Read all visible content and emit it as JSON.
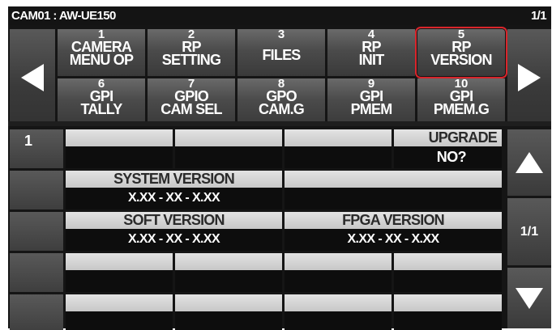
{
  "header": {
    "camera": "CAM01 : AW-UE150",
    "page": "1/1"
  },
  "menu": [
    {
      "num": "1",
      "label": "CAMERA\nMENU OP"
    },
    {
      "num": "2",
      "label": "RP\nSETTING"
    },
    {
      "num": "3",
      "label": "FILES"
    },
    {
      "num": "4",
      "label": "RP\nINIT"
    },
    {
      "num": "5",
      "label": "RP\nVERSION",
      "selected": true
    },
    {
      "num": "6",
      "label": "GPI\nTALLY"
    },
    {
      "num": "7",
      "label": "GPIO\nCAM SEL"
    },
    {
      "num": "8",
      "label": "GPO\nCAM.G"
    },
    {
      "num": "9",
      "label": "GPI\nPMEM"
    },
    {
      "num": "10",
      "label": "GPI\nPMEM.G"
    }
  ],
  "rows": {
    "row1": {
      "label": "1",
      "upgrade": "UPGRADE",
      "upgrade_value": "NO?"
    },
    "system_version": {
      "label": "SYSTEM VERSION",
      "value": "X.XX - XX - X.XX"
    },
    "soft_version": {
      "label": "SOFT VERSION",
      "value": "X.XX - XX - X.XX"
    },
    "fpga_version": {
      "label": "FPGA VERSION",
      "value": "X.XX - XX - X.XX"
    }
  },
  "pager": {
    "page": "1/1"
  },
  "icons": {
    "prev": "triangle-left-icon",
    "next": "triangle-right-icon",
    "up": "triangle-up-icon",
    "down": "triangle-down-icon"
  },
  "colors": {
    "selected_outline": "#d9252b",
    "background": "#151515",
    "cell_header": "#d5d5d5"
  }
}
